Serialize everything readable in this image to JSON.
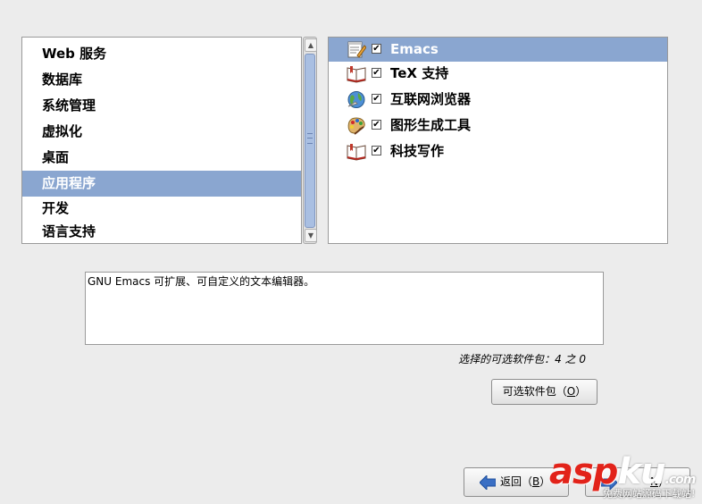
{
  "categories": [
    {
      "label": "Web 服务",
      "selected": false
    },
    {
      "label": "数据库",
      "selected": false
    },
    {
      "label": "系统管理",
      "selected": false
    },
    {
      "label": "虚拟化",
      "selected": false
    },
    {
      "label": "桌面",
      "selected": false
    },
    {
      "label": "应用程序",
      "selected": true
    },
    {
      "label": "开发",
      "selected": false
    },
    {
      "label": "语言支持",
      "selected": false
    }
  ],
  "scrollbar": {
    "up_arrow": "▲",
    "down_arrow": "▼"
  },
  "packages": [
    {
      "label": "Emacs",
      "icon": "text-editor-icon",
      "checked": true,
      "selected": true
    },
    {
      "label": "TeX 支持",
      "icon": "book-icon",
      "checked": true,
      "selected": false
    },
    {
      "label": "互联网浏览器",
      "icon": "globe-icon",
      "checked": true,
      "selected": false
    },
    {
      "label": "图形生成工具",
      "icon": "palette-icon",
      "checked": true,
      "selected": false
    },
    {
      "label": "科技写作",
      "icon": "book-icon",
      "checked": true,
      "selected": false
    }
  ],
  "check_mark": "✔",
  "description": "GNU Emacs 可扩展、可自定义的文本编辑器。",
  "selected_count": "选择的可选软件包：4 之 0",
  "buttons": {
    "optional_packages": {
      "label": "可选软件包（",
      "key": "O",
      "end": "）"
    },
    "back": {
      "label": "返回（",
      "key": "B",
      "end": "）"
    },
    "next": {
      "label": "",
      "key": "N",
      "end": ")"
    }
  },
  "watermark": {
    "logo_main": "asp",
    "logo_ku": "ku",
    "logo_com": ".com",
    "tagline": "免费网站源码下载站!"
  },
  "colors": {
    "selection": "#8aa6d0",
    "arrow_blue": "#3a6fc4"
  }
}
